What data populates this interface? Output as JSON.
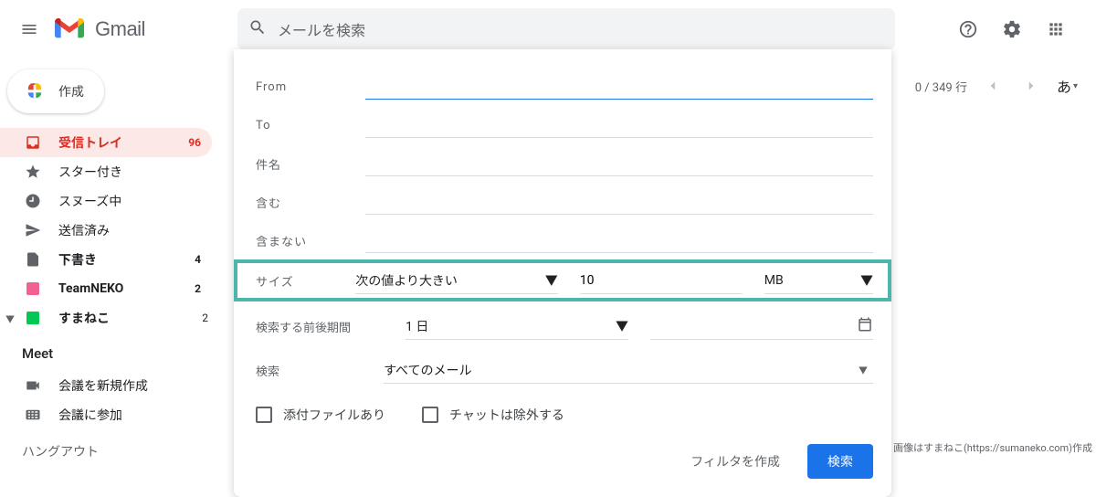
{
  "header": {
    "logo_text": "Gmail",
    "search_placeholder": "メールを検索",
    "ime_label": "あ"
  },
  "compose": {
    "label": "作成"
  },
  "sidebar": {
    "items": [
      {
        "label": "受信トレイ",
        "count": "96"
      },
      {
        "label": "スター付き",
        "count": ""
      },
      {
        "label": "スヌーズ中",
        "count": ""
      },
      {
        "label": "送信済み",
        "count": ""
      },
      {
        "label": "下書き",
        "count": "4"
      },
      {
        "label": "TeamNEKO",
        "count": "2"
      },
      {
        "label": "すまねこ",
        "count": "2"
      }
    ]
  },
  "meet": {
    "header": "Meet",
    "new": "会議を新規作成",
    "join": "会議に参加"
  },
  "hangout": {
    "header": "ハングアウト"
  },
  "main": {
    "counter": "0 / 349 行"
  },
  "panel": {
    "from_label": "From",
    "to_label": "To",
    "subject_label": "件名",
    "has_label": "含む",
    "nohas_label": "含まない",
    "size_label": "サイズ",
    "size_op": "次の値より大きい",
    "size_value": "10",
    "size_unit": "MB",
    "date_label": "検索する前後期間",
    "date_value": "1 日",
    "search_in_label": "検索",
    "search_in_value": "すべてのメール",
    "check_attach": "添付ファイルあり",
    "check_chat": "チャットは除外する",
    "filter_btn": "フィルタを作成",
    "search_btn": "検索"
  },
  "attribution": "画像はすまねこ(https://sumaneko.com)作成"
}
